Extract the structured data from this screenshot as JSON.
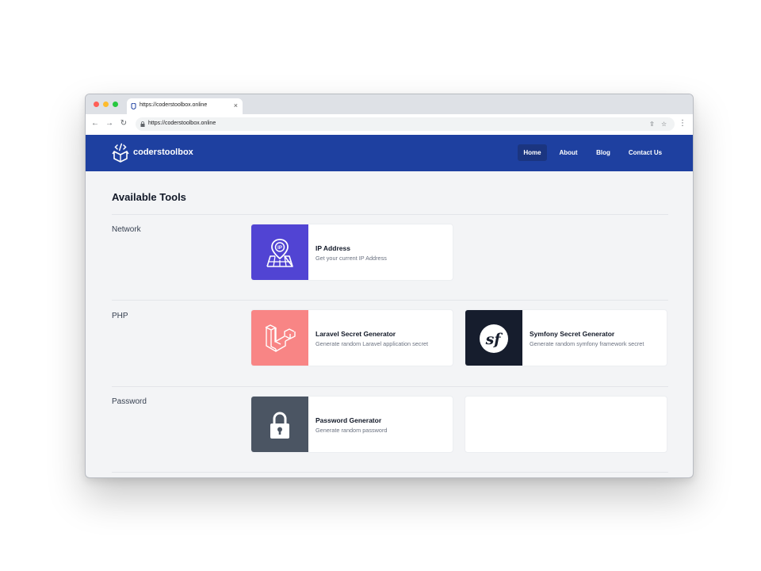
{
  "browser": {
    "tab_title": "https://coderstoolbox.online",
    "tab_close": "×",
    "url": "https://coderstoolbox.online",
    "controls": {
      "back": "←",
      "forward": "→",
      "reload": "↻",
      "share": "⇪",
      "bookmark": "☆",
      "menu": "⋮"
    }
  },
  "site": {
    "logo_text": "coderstoolbox",
    "nav": [
      {
        "label": "Home",
        "active": true
      },
      {
        "label": "About",
        "active": false
      },
      {
        "label": "Blog",
        "active": false
      },
      {
        "label": "Contact Us",
        "active": false
      }
    ]
  },
  "page": {
    "title": "Available Tools",
    "categories": [
      {
        "name": "Network",
        "tools": [
          {
            "title": "IP Address",
            "description": "Get your current IP Address",
            "icon": "ip-location-icon",
            "color": "#5144d3"
          }
        ]
      },
      {
        "name": "PHP",
        "tools": [
          {
            "title": "Laravel Secret Generator",
            "description": "Generate random Laravel application secret",
            "icon": "laravel-icon",
            "color": "#f88585"
          },
          {
            "title": "Symfony Secret Generator",
            "description": "Generate random symfony framework secret",
            "icon": "symfony-icon",
            "color": "#161d2d"
          }
        ]
      },
      {
        "name": "Password",
        "tools": [
          {
            "title": "Password Generator",
            "description": "Generate random password",
            "icon": "padlock-icon",
            "color": "#4b5563"
          }
        ]
      }
    ]
  }
}
